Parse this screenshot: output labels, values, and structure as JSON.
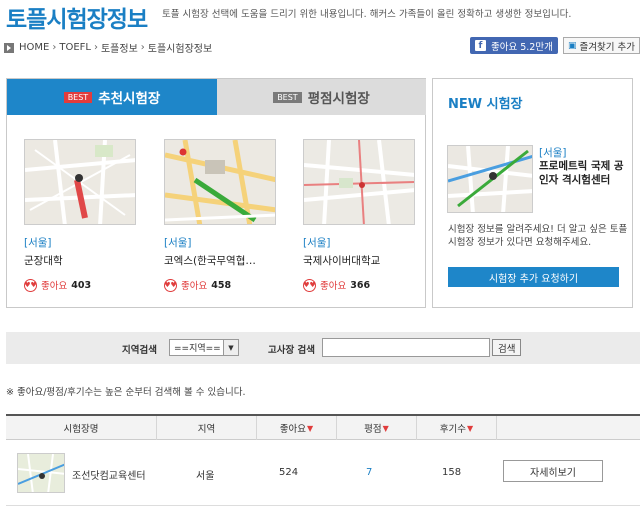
{
  "header": {
    "title": "토플시험장정보",
    "description": "토플 시험장 선택에 도움을 드리기 위한 내용입니다. 해커스 가족들이 올린 정확하고 생생한 정보입니다."
  },
  "breadcrumb": [
    "HOME",
    "TOEFL",
    "토플정보",
    "토플시험장정보"
  ],
  "social": {
    "like_label": "좋아요 5.2만개",
    "fav_label": "즐겨찾기 추가"
  },
  "best": {
    "tabs": [
      {
        "badge": "BEST",
        "label": "추천시험장"
      },
      {
        "badge": "BEST",
        "label": "평점시험장"
      }
    ],
    "like_label": "좋아요",
    "cards": [
      {
        "region": "[서울]",
        "name": "군장대학",
        "likes": "403"
      },
      {
        "region": "[서울]",
        "name": "코엑스(한국무역협…",
        "likes": "458"
      },
      {
        "region": "[서울]",
        "name": "국제사이버대학교",
        "likes": "366"
      }
    ]
  },
  "new_center": {
    "title": "NEW 시험장",
    "region": "[서울]",
    "name": "프로메트릭 국제 공인자 격시험센터",
    "info": "시험장 정보를 알려주세요! 더 알고 싶은 토플 시험장 정보가 있다면 요청해주세요.",
    "request_button": "시험장 추가 요청하기"
  },
  "search": {
    "region_label": "지역검색",
    "region_value": "==지역==",
    "center_label": "고사장 검색",
    "input_value": "",
    "button": "검색"
  },
  "note": "※ 좋아요/평점/후기수는 높은 순부터 검색해 볼 수 있습니다.",
  "table": {
    "headers": [
      "시험장명",
      "지역",
      "좋아요",
      "평점",
      "후기수"
    ],
    "rows": [
      {
        "name": "조선닷컴교육센터",
        "region": "서울",
        "likes": "524",
        "rating": "7",
        "reviews": "158",
        "button": "자세히보기"
      }
    ]
  },
  "colors": {
    "accent": "#1e86c9",
    "heart": "#e03d3d",
    "facebook": "#4267b2"
  }
}
